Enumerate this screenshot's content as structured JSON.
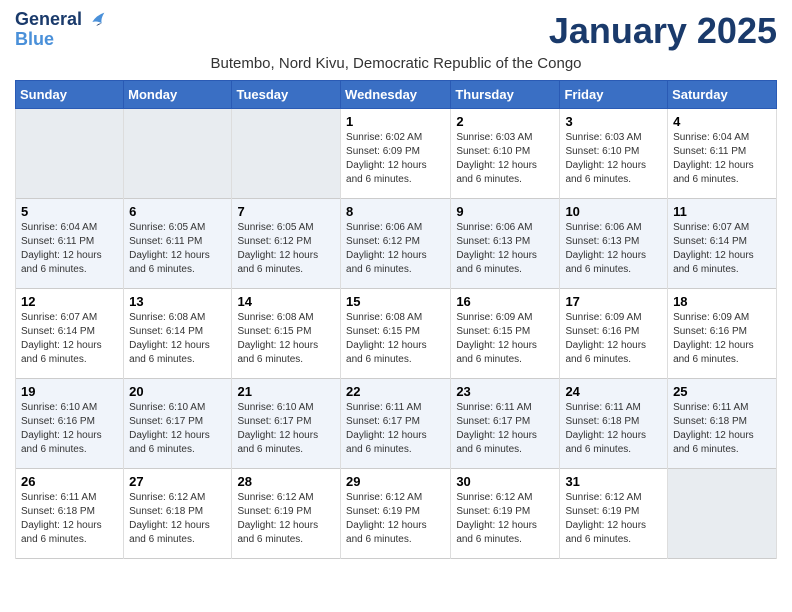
{
  "logo": {
    "line1": "General",
    "line2": "Blue"
  },
  "title": "January 2025",
  "subtitle": "Butembo, Nord Kivu, Democratic Republic of the Congo",
  "weekdays": [
    "Sunday",
    "Monday",
    "Tuesday",
    "Wednesday",
    "Thursday",
    "Friday",
    "Saturday"
  ],
  "weeks": [
    [
      {
        "day": "",
        "sunrise": "",
        "sunset": "",
        "daylight": "",
        "empty": true
      },
      {
        "day": "",
        "sunrise": "",
        "sunset": "",
        "daylight": "",
        "empty": true
      },
      {
        "day": "",
        "sunrise": "",
        "sunset": "",
        "daylight": "",
        "empty": true
      },
      {
        "day": "1",
        "sunrise": "Sunrise: 6:02 AM",
        "sunset": "Sunset: 6:09 PM",
        "daylight": "Daylight: 12 hours and 6 minutes.",
        "empty": false
      },
      {
        "day": "2",
        "sunrise": "Sunrise: 6:03 AM",
        "sunset": "Sunset: 6:10 PM",
        "daylight": "Daylight: 12 hours and 6 minutes.",
        "empty": false
      },
      {
        "day": "3",
        "sunrise": "Sunrise: 6:03 AM",
        "sunset": "Sunset: 6:10 PM",
        "daylight": "Daylight: 12 hours and 6 minutes.",
        "empty": false
      },
      {
        "day": "4",
        "sunrise": "Sunrise: 6:04 AM",
        "sunset": "Sunset: 6:11 PM",
        "daylight": "Daylight: 12 hours and 6 minutes.",
        "empty": false
      }
    ],
    [
      {
        "day": "5",
        "sunrise": "Sunrise: 6:04 AM",
        "sunset": "Sunset: 6:11 PM",
        "daylight": "Daylight: 12 hours and 6 minutes.",
        "empty": false
      },
      {
        "day": "6",
        "sunrise": "Sunrise: 6:05 AM",
        "sunset": "Sunset: 6:11 PM",
        "daylight": "Daylight: 12 hours and 6 minutes.",
        "empty": false
      },
      {
        "day": "7",
        "sunrise": "Sunrise: 6:05 AM",
        "sunset": "Sunset: 6:12 PM",
        "daylight": "Daylight: 12 hours and 6 minutes.",
        "empty": false
      },
      {
        "day": "8",
        "sunrise": "Sunrise: 6:06 AM",
        "sunset": "Sunset: 6:12 PM",
        "daylight": "Daylight: 12 hours and 6 minutes.",
        "empty": false
      },
      {
        "day": "9",
        "sunrise": "Sunrise: 6:06 AM",
        "sunset": "Sunset: 6:13 PM",
        "daylight": "Daylight: 12 hours and 6 minutes.",
        "empty": false
      },
      {
        "day": "10",
        "sunrise": "Sunrise: 6:06 AM",
        "sunset": "Sunset: 6:13 PM",
        "daylight": "Daylight: 12 hours and 6 minutes.",
        "empty": false
      },
      {
        "day": "11",
        "sunrise": "Sunrise: 6:07 AM",
        "sunset": "Sunset: 6:14 PM",
        "daylight": "Daylight: 12 hours and 6 minutes.",
        "empty": false
      }
    ],
    [
      {
        "day": "12",
        "sunrise": "Sunrise: 6:07 AM",
        "sunset": "Sunset: 6:14 PM",
        "daylight": "Daylight: 12 hours and 6 minutes.",
        "empty": false
      },
      {
        "day": "13",
        "sunrise": "Sunrise: 6:08 AM",
        "sunset": "Sunset: 6:14 PM",
        "daylight": "Daylight: 12 hours and 6 minutes.",
        "empty": false
      },
      {
        "day": "14",
        "sunrise": "Sunrise: 6:08 AM",
        "sunset": "Sunset: 6:15 PM",
        "daylight": "Daylight: 12 hours and 6 minutes.",
        "empty": false
      },
      {
        "day": "15",
        "sunrise": "Sunrise: 6:08 AM",
        "sunset": "Sunset: 6:15 PM",
        "daylight": "Daylight: 12 hours and 6 minutes.",
        "empty": false
      },
      {
        "day": "16",
        "sunrise": "Sunrise: 6:09 AM",
        "sunset": "Sunset: 6:15 PM",
        "daylight": "Daylight: 12 hours and 6 minutes.",
        "empty": false
      },
      {
        "day": "17",
        "sunrise": "Sunrise: 6:09 AM",
        "sunset": "Sunset: 6:16 PM",
        "daylight": "Daylight: 12 hours and 6 minutes.",
        "empty": false
      },
      {
        "day": "18",
        "sunrise": "Sunrise: 6:09 AM",
        "sunset": "Sunset: 6:16 PM",
        "daylight": "Daylight: 12 hours and 6 minutes.",
        "empty": false
      }
    ],
    [
      {
        "day": "19",
        "sunrise": "Sunrise: 6:10 AM",
        "sunset": "Sunset: 6:16 PM",
        "daylight": "Daylight: 12 hours and 6 minutes.",
        "empty": false
      },
      {
        "day": "20",
        "sunrise": "Sunrise: 6:10 AM",
        "sunset": "Sunset: 6:17 PM",
        "daylight": "Daylight: 12 hours and 6 minutes.",
        "empty": false
      },
      {
        "day": "21",
        "sunrise": "Sunrise: 6:10 AM",
        "sunset": "Sunset: 6:17 PM",
        "daylight": "Daylight: 12 hours and 6 minutes.",
        "empty": false
      },
      {
        "day": "22",
        "sunrise": "Sunrise: 6:11 AM",
        "sunset": "Sunset: 6:17 PM",
        "daylight": "Daylight: 12 hours and 6 minutes.",
        "empty": false
      },
      {
        "day": "23",
        "sunrise": "Sunrise: 6:11 AM",
        "sunset": "Sunset: 6:17 PM",
        "daylight": "Daylight: 12 hours and 6 minutes.",
        "empty": false
      },
      {
        "day": "24",
        "sunrise": "Sunrise: 6:11 AM",
        "sunset": "Sunset: 6:18 PM",
        "daylight": "Daylight: 12 hours and 6 minutes.",
        "empty": false
      },
      {
        "day": "25",
        "sunrise": "Sunrise: 6:11 AM",
        "sunset": "Sunset: 6:18 PM",
        "daylight": "Daylight: 12 hours and 6 minutes.",
        "empty": false
      }
    ],
    [
      {
        "day": "26",
        "sunrise": "Sunrise: 6:11 AM",
        "sunset": "Sunset: 6:18 PM",
        "daylight": "Daylight: 12 hours and 6 minutes.",
        "empty": false
      },
      {
        "day": "27",
        "sunrise": "Sunrise: 6:12 AM",
        "sunset": "Sunset: 6:18 PM",
        "daylight": "Daylight: 12 hours and 6 minutes.",
        "empty": false
      },
      {
        "day": "28",
        "sunrise": "Sunrise: 6:12 AM",
        "sunset": "Sunset: 6:19 PM",
        "daylight": "Daylight: 12 hours and 6 minutes.",
        "empty": false
      },
      {
        "day": "29",
        "sunrise": "Sunrise: 6:12 AM",
        "sunset": "Sunset: 6:19 PM",
        "daylight": "Daylight: 12 hours and 6 minutes.",
        "empty": false
      },
      {
        "day": "30",
        "sunrise": "Sunrise: 6:12 AM",
        "sunset": "Sunset: 6:19 PM",
        "daylight": "Daylight: 12 hours and 6 minutes.",
        "empty": false
      },
      {
        "day": "31",
        "sunrise": "Sunrise: 6:12 AM",
        "sunset": "Sunset: 6:19 PM",
        "daylight": "Daylight: 12 hours and 6 minutes.",
        "empty": false
      },
      {
        "day": "",
        "sunrise": "",
        "sunset": "",
        "daylight": "",
        "empty": true
      }
    ]
  ]
}
